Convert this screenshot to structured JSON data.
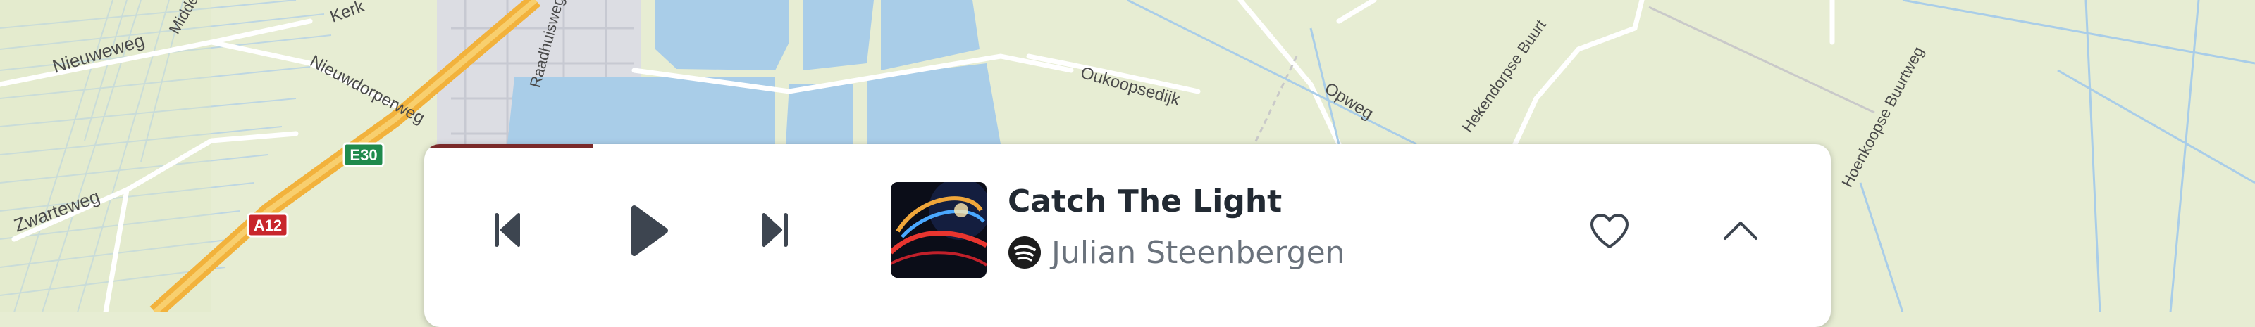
{
  "map": {
    "labels": {
      "nieuweweg": "Nieuweweg",
      "middel": "Midde",
      "kerk": "Kerk",
      "nieuwdorperweg": "Nieuwdorperweg",
      "raadhuisweg": "Raadhuisweg",
      "zwarteweg": "Zwarteweg",
      "oukoopsedijk": "Oukoopsedijk",
      "opweg": "Opweg",
      "hekendorpse_buurt": "Hekendorpse Buurt",
      "hoenkoopse_buurtweg": "Hoenkoopse Buurtweg"
    },
    "shields": {
      "e30": "E30",
      "a12": "A12"
    },
    "colors": {
      "land": "#e7edd3",
      "water": "#a9cde8",
      "motorway": "#f2b23c",
      "e_shield": "#1f8a4c",
      "a_shield": "#c8262c"
    }
  },
  "player": {
    "track_title": "Catch The Light",
    "artist": "Julian Steenbergen",
    "source_icon": "spotify-icon",
    "progress": 0.12,
    "controls": {
      "previous": "skip-previous-icon",
      "play": "play-icon",
      "next": "skip-next-icon",
      "favorite": "heart-icon",
      "expand": "chevron-up-icon"
    },
    "colors": {
      "progress": "#7a2a2a",
      "title": "#222a33",
      "artist": "#6a727c",
      "icon": "#3d4550"
    }
  }
}
